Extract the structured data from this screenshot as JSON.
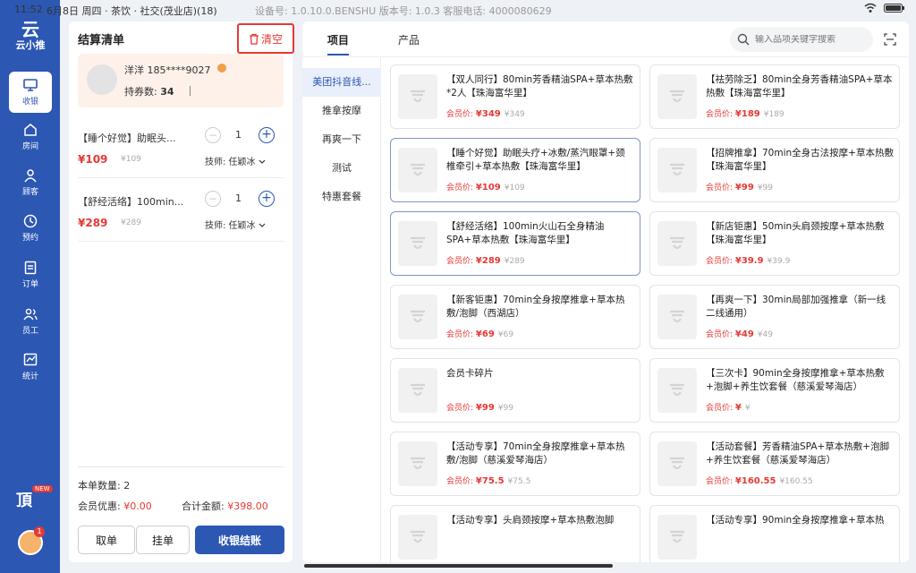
{
  "status_bar": {
    "time": "11:52",
    "store": "6月8日 周四 · 茶饮 · 社交(茂业店)(18)",
    "device": "设备号: 1.0.10.0.BENSHU  版本号: 1.0.3  客服电话: 4000080629"
  },
  "nav": {
    "logo_mark": "云",
    "logo_text": "云小推",
    "items": [
      {
        "label": "收银",
        "icon": "monitor-icon"
      },
      {
        "label": "房间",
        "icon": "home-icon"
      },
      {
        "label": "顾客",
        "icon": "user-icon"
      },
      {
        "label": "预约",
        "icon": "clock-icon"
      },
      {
        "label": "订单",
        "icon": "document-icon"
      },
      {
        "label": "员工",
        "icon": "team-icon"
      },
      {
        "label": "统计",
        "icon": "chart-icon"
      }
    ],
    "bottom_label": "頂",
    "new_badge": "NEW",
    "avatar_badge": "1"
  },
  "cart": {
    "title": "结算清单",
    "clear_label": "清空",
    "member": {
      "name": "洋洋 185****9027",
      "coupon_label": "持券数:",
      "coupon_count": "34"
    },
    "items": [
      {
        "name": "【睡个好觉】助眠头...",
        "qty": "1",
        "price": "¥109",
        "orig": "¥109",
        "tech": "技师: 任颖冰"
      },
      {
        "name": "【舒经活络】100min...",
        "qty": "1",
        "price": "¥289",
        "orig": "¥289",
        "tech": "技师: 任颖冰"
      }
    ],
    "count_label": "本单数量: ",
    "count": "2",
    "discount_label": "会员优惠: ",
    "discount": "¥0.00",
    "total_label": "合计金额: ",
    "total": "¥398.00",
    "buttons": {
      "cancel": "取单",
      "hold": "挂单",
      "checkout": "收银结账"
    }
  },
  "products": {
    "tabs": [
      "项目",
      "产品"
    ],
    "search_placeholder": "输入品项关键字搜索",
    "categories": [
      "美团抖音线...",
      "推拿按摩",
      "再爽一下",
      "测试",
      "特惠套餐"
    ],
    "price_label": "会员价: ",
    "cards": [
      {
        "title": "【双人同行】80min芳香精油SPA+草本热敷*2人【珠海富华里】",
        "price": "¥349",
        "orig": "¥349"
      },
      {
        "title": "【祛劳除乏】80min全身芳香精油SPA+草本热敷【珠海富华里】",
        "price": "¥189",
        "orig": "¥189"
      },
      {
        "title": "【睡个好觉】助眠头疗+冰敷/蒸汽眼罩+颈椎牵引+草本热敷【珠海富华里】",
        "price": "¥109",
        "orig": "¥109"
      },
      {
        "title": "【招牌推拿】70min全身古法按摩+草本热敷【珠海富华里】",
        "price": "¥99",
        "orig": "¥99"
      },
      {
        "title": "【舒经活络】100min火山石全身精油SPA+草本热敷【珠海富华里】",
        "price": "¥289",
        "orig": "¥289"
      },
      {
        "title": "【新店钜惠】50min头肩颈按摩+草本热敷【珠海富华里】",
        "price": "¥39.9",
        "orig": "¥39.9"
      },
      {
        "title": "【新客钜惠】70min全身按摩推拿+草本热敷/泡脚（西湖店）",
        "price": "¥69",
        "orig": "¥69"
      },
      {
        "title": "【再爽一下】30min局部加强推拿（新一线二线通用）",
        "price": "¥49",
        "orig": "¥49"
      },
      {
        "title": "会员卡碎片",
        "price": "¥99",
        "orig": "¥99"
      },
      {
        "title": "【三次卡】90min全身按摩推拿+草本热敷+泡脚+养生饮套餐（慈溪爱琴海店）",
        "price": "¥",
        "orig": "¥"
      },
      {
        "title": "【活动专享】70min全身按摩推拿+草本热敷/泡脚（慈溪爱琴海店）",
        "price": "¥75.5",
        "orig": "¥75.5"
      },
      {
        "title": "【活动套餐】芳香精油SPA+草本热敷+泡脚+养生饮套餐（慈溪爱琴海店）",
        "price": "¥160.55",
        "orig": "¥160.55"
      },
      {
        "title": "【活动专享】头肩颈按摩+草本热敷泡脚",
        "price": "",
        "orig": ""
      },
      {
        "title": "【活动专享】90min全身按摩推拿+草本热",
        "price": "",
        "orig": ""
      }
    ]
  }
}
